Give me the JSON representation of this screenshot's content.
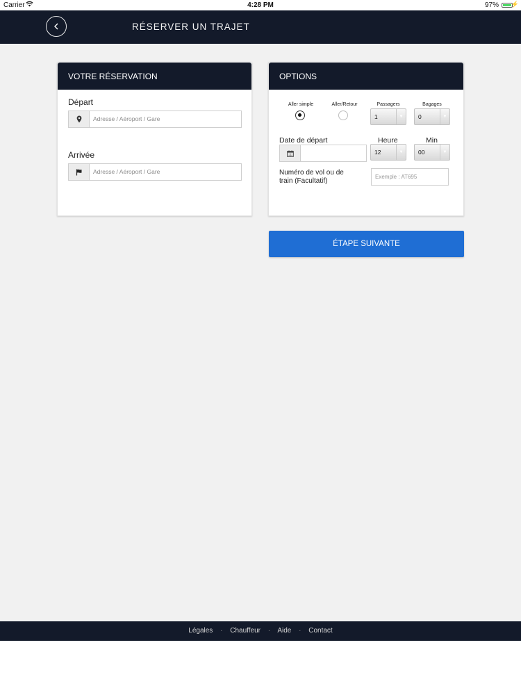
{
  "status_bar": {
    "carrier": "Carrier",
    "time": "4:28 PM",
    "battery": "97%",
    "battery_level": 0.97
  },
  "header": {
    "title": "RÉSERVER UN TRAJET"
  },
  "reservation": {
    "title": "VOTRE RÉSERVATION",
    "departure_label": "Départ",
    "departure_placeholder": "Adresse / Aéroport / Gare",
    "arrival_label": "Arrivée",
    "arrival_placeholder": "Adresse / Aéroport / Gare"
  },
  "options": {
    "title": "OPTIONS",
    "one_way_label": "Aller simple",
    "round_trip_label": "Aller/Retour",
    "selected_trip": "Aller simple",
    "passengers_label": "Passagers",
    "passengers_value": "1",
    "luggage_label": "Bagages",
    "luggage_value": "0",
    "date_label": "Date de départ",
    "date_value": "",
    "hour_label": "Heure",
    "hour_value": "12",
    "min_label": "Min",
    "min_value": "00",
    "flight_label_line1": "Numéro de vol ou de",
    "flight_label_line2": "train (Facultatif)",
    "flight_placeholder": "Exemple : AT695"
  },
  "next_button": "ÉTAPE SUIVANTE",
  "footer": {
    "links": [
      "Légales",
      "Chauffeur",
      "Aide",
      "Contact"
    ],
    "separator": "·"
  },
  "icons": {
    "back": "chevron-left-icon",
    "departure": "map-marker-icon",
    "arrival": "flag-icon",
    "date": "calendar-icon"
  },
  "colors": {
    "nav": "#131a2a",
    "accent": "#1f6ed4",
    "background": "#f1f1f1"
  }
}
